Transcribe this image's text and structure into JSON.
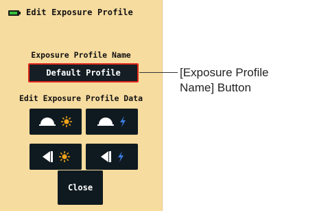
{
  "screen": {
    "title": "Edit Exposure Profile",
    "profile_name_label": "Exposure Profile Name",
    "profile_name_button": "Default Profile",
    "profile_data_label": "Edit Exposure Profile Data",
    "data_buttons": [
      {
        "icon": "dome-icon",
        "mode": "sun-icon"
      },
      {
        "icon": "dome-icon",
        "mode": "flash-icon"
      },
      {
        "icon": "flat-disc-icon",
        "mode": "sun-icon"
      },
      {
        "icon": "flat-disc-icon",
        "mode": "flash-icon"
      }
    ],
    "close_button": "Close"
  },
  "annotation": {
    "line1": "[Exposure Profile",
    "line2": "Name] Button"
  },
  "colors": {
    "screen_bg": "#f7dc9f",
    "button_bg": "#0f1a20",
    "highlight_border": "#e0261d",
    "sun": "#f0a21a",
    "flash": "#3b7de0"
  }
}
